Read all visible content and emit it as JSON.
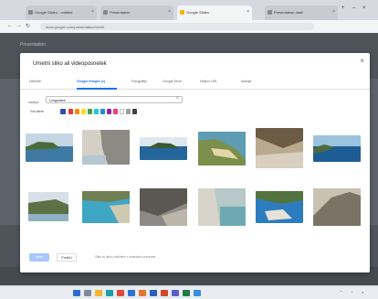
{
  "browser": {
    "tabs": [
      {
        "label": "Google Slides - untitled",
        "active": false
      },
      {
        "label": "Presentation",
        "active": false
      },
      {
        "label": "Google Slides",
        "active": true
      },
      {
        "label": "Presentation draft",
        "active": false
      }
    ],
    "url": "docs.google.com/presentation/d/edit"
  },
  "page": {
    "heading": "Presentation"
  },
  "dialog": {
    "title": "Umetni sliko ali videoposnetek",
    "close_icon": "close-icon",
    "tabs": [
      "Naložite",
      "Google Images (v)",
      "Fotografije",
      "Google Drive",
      "Naslov URL",
      "Iskanje"
    ],
    "active_tab": "Google Images (v)",
    "search": {
      "label": "Iskanje:",
      "value": "Lungomare",
      "icon": "search-icon"
    },
    "filter": {
      "label": "Vse barve",
      "icon": "palette-icon"
    },
    "swatch_colors": [
      "#e53935",
      "#fb8c00",
      "#fdd835",
      "#43a047",
      "#26c6da",
      "#1e88e5",
      "#8e24aa",
      "#ec407a",
      "#ffffff",
      "#9e9e9e",
      "#424242"
    ],
    "images": [
      {
        "alt": "coastal cliff over sea"
      },
      {
        "alt": "rock wall coast"
      },
      {
        "alt": "green island in sea"
      },
      {
        "alt": "sandy cape and beach"
      },
      {
        "alt": "eroded cliff face"
      },
      {
        "alt": "blue bay with rocks"
      },
      {
        "alt": "headland with trees"
      },
      {
        "alt": "turquoise cove"
      },
      {
        "alt": "rocky shore"
      },
      {
        "alt": "pale cliffs and sea"
      },
      {
        "alt": "blue lagoon with boat"
      },
      {
        "alt": "rocky slope"
      }
    ],
    "buttons": {
      "select": "Izberi",
      "cancel": "Prekliči"
    },
    "note": "Slike so lahko zaščitene z avtorskimi pravicami"
  },
  "taskbar": {
    "icons": [
      "windows-icon",
      "search-icon",
      "file-explorer-icon",
      "edge-icon",
      "chrome-icon",
      "mail-icon",
      "store-icon",
      "word-icon",
      "powerpoint-icon",
      "teams-icon",
      "excel-icon",
      "photos-icon"
    ]
  }
}
